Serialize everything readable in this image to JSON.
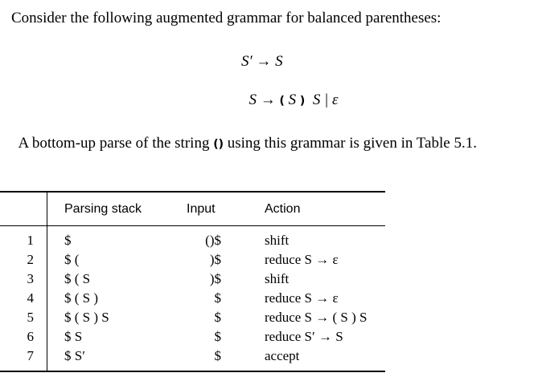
{
  "intro": "Consider the following augmented grammar for balanced parentheses:",
  "grammar": {
    "line1": "S′ → S",
    "line2_lhs": "S → ",
    "line2_open": "(",
    "line2_mid": " S ",
    "line2_close": ")",
    "line2_rest": "  S | ε"
  },
  "sentence": {
    "before": "A bottom-up parse of the string ",
    "string": "()",
    "after": " using this grammar is given in Table 5.1."
  },
  "table": {
    "headers": [
      "Parsing stack",
      "Input",
      "Action"
    ],
    "rows": [
      {
        "n": "1",
        "stack": "$",
        "input": "()$",
        "action": "shift"
      },
      {
        "n": "2",
        "stack": "$ (",
        "input": ")$",
        "action": "reduce S → ε"
      },
      {
        "n": "3",
        "stack": "$ ( S",
        "input": ")$",
        "action": "shift"
      },
      {
        "n": "4",
        "stack": "$ ( S )",
        "input": "$",
        "action": "reduce S → ε"
      },
      {
        "n": "5",
        "stack": "$ ( S ) S",
        "input": "$",
        "action": "reduce S → ( S ) S"
      },
      {
        "n": "6",
        "stack": "$ S",
        "input": "$",
        "action": "reduce S′ → S"
      },
      {
        "n": "7",
        "stack": "$ S′",
        "input": "$",
        "action": "accept"
      }
    ]
  }
}
